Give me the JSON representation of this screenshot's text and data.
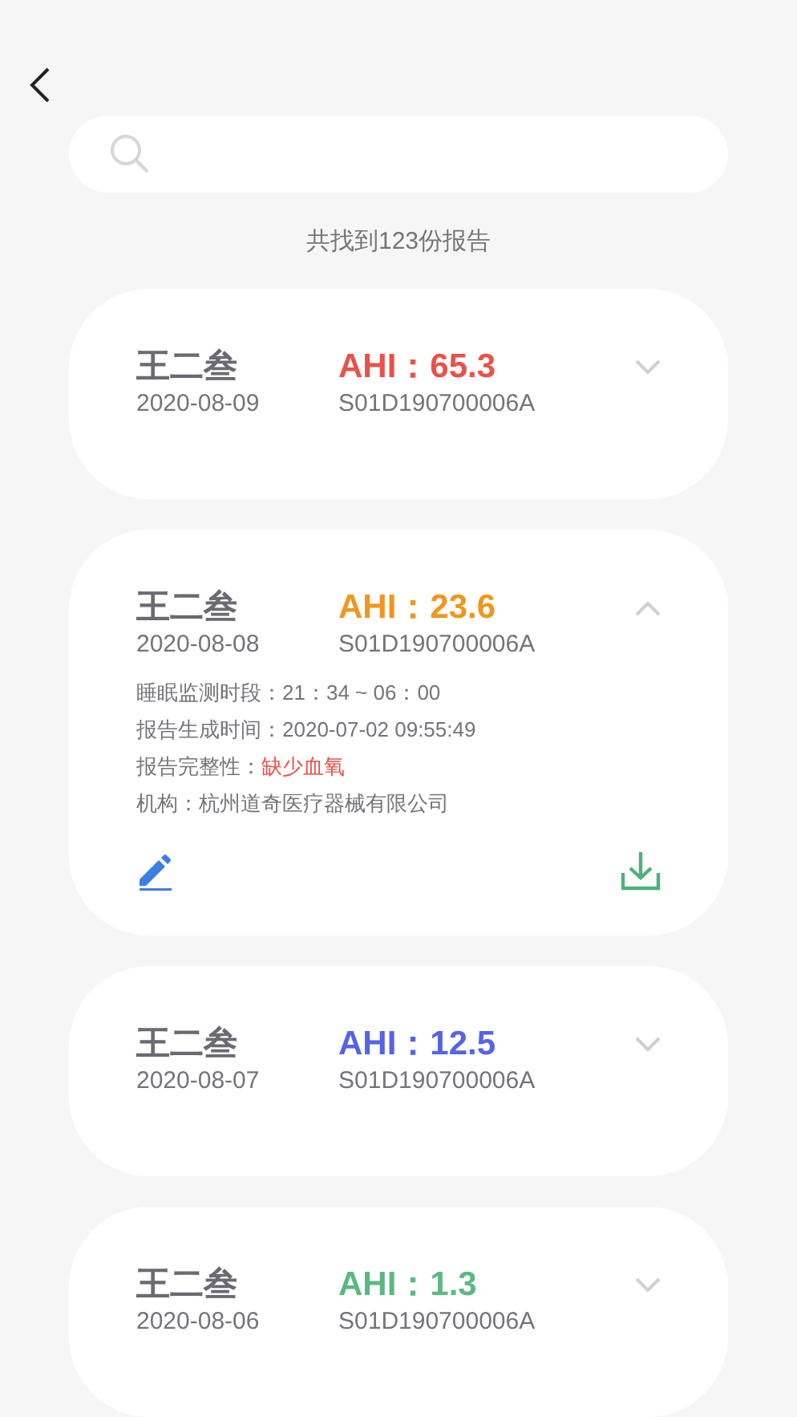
{
  "result_count": "共找到123份报告",
  "reports": [
    {
      "name": "王二叁",
      "date": "2020-08-09",
      "ahi": "AHI：65.3",
      "color": "#e8524a",
      "serial": "S01D190700006A",
      "expanded": false
    },
    {
      "name": "王二叁",
      "date": "2020-08-08",
      "ahi": "AHI：23.6",
      "color": "#f0961e",
      "serial": "S01D190700006A",
      "expanded": true,
      "details": [
        {
          "label": "睡眠监测时段：",
          "value": "21：34 ~ 06：00",
          "warning": false
        },
        {
          "label": "报告生成时间：",
          "value": "2020-07-02 09:55:49",
          "warning": false
        },
        {
          "label": "报告完整性：",
          "value": "缺少血氧",
          "warning": true
        },
        {
          "label": "机构：",
          "value": "杭州道奇医疗器械有限公司",
          "warning": false
        }
      ]
    },
    {
      "name": "王二叁",
      "date": "2020-08-07",
      "ahi": "AHI：12.5",
      "color": "#5563e8",
      "serial": "S01D190700006A",
      "expanded": false
    },
    {
      "name": "王二叁",
      "date": "2020-08-06",
      "ahi": "AHI：1.3",
      "color": "#5cb882",
      "serial": "S01D190700006A",
      "expanded": false
    }
  ]
}
